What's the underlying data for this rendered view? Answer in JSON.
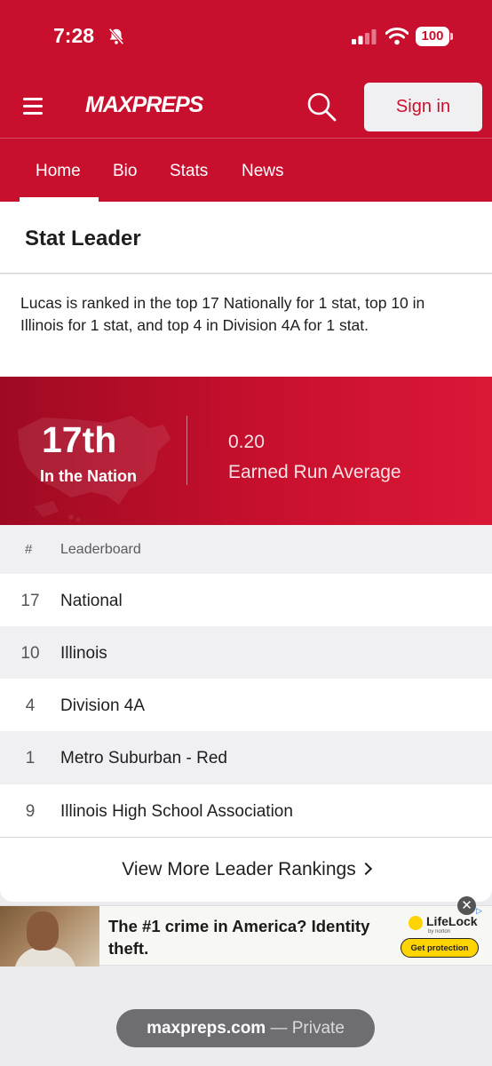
{
  "status_bar": {
    "time": "7:28",
    "battery": "100"
  },
  "header": {
    "logo": "MAXPREPS",
    "sign_in": "Sign in"
  },
  "tabs": [
    {
      "label": "Home"
    },
    {
      "label": "Bio"
    },
    {
      "label": "Stats"
    },
    {
      "label": "News"
    }
  ],
  "active_tab": "Home",
  "section": {
    "title": "Stat Leader",
    "summary": "Lucas is ranked in the top 17 Nationally for 1 stat, top 10 in Illinois for 1 stat, and top 4 in Division 4A for 1 stat."
  },
  "highlight": {
    "rank": "17th",
    "scope": "In the Nation",
    "stat_value": "0.20",
    "stat_name": "Earned Run Average"
  },
  "leaderboard": {
    "col_rank": "#",
    "col_name": "Leaderboard",
    "rows": [
      {
        "rank": "17",
        "name": "National"
      },
      {
        "rank": "10",
        "name": "Illinois"
      },
      {
        "rank": "4",
        "name": "Division 4A"
      },
      {
        "rank": "1",
        "name": "Metro Suburban - Red"
      },
      {
        "rank": "9",
        "name": "Illinois High School Association"
      }
    ]
  },
  "view_more": "View More Leader Rankings",
  "ad": {
    "headline": "The #1 crime in America? Identity theft.",
    "brand": "LifeLock",
    "brand_sub": "by norton",
    "cta": "Get protection",
    "close": "✕"
  },
  "browser": {
    "host": "maxpreps.com",
    "mode": "— Private"
  },
  "colors": {
    "brand_red": "#c8102e",
    "row_alt": "#f0f0f2",
    "cta_yellow": "#ffd400"
  }
}
